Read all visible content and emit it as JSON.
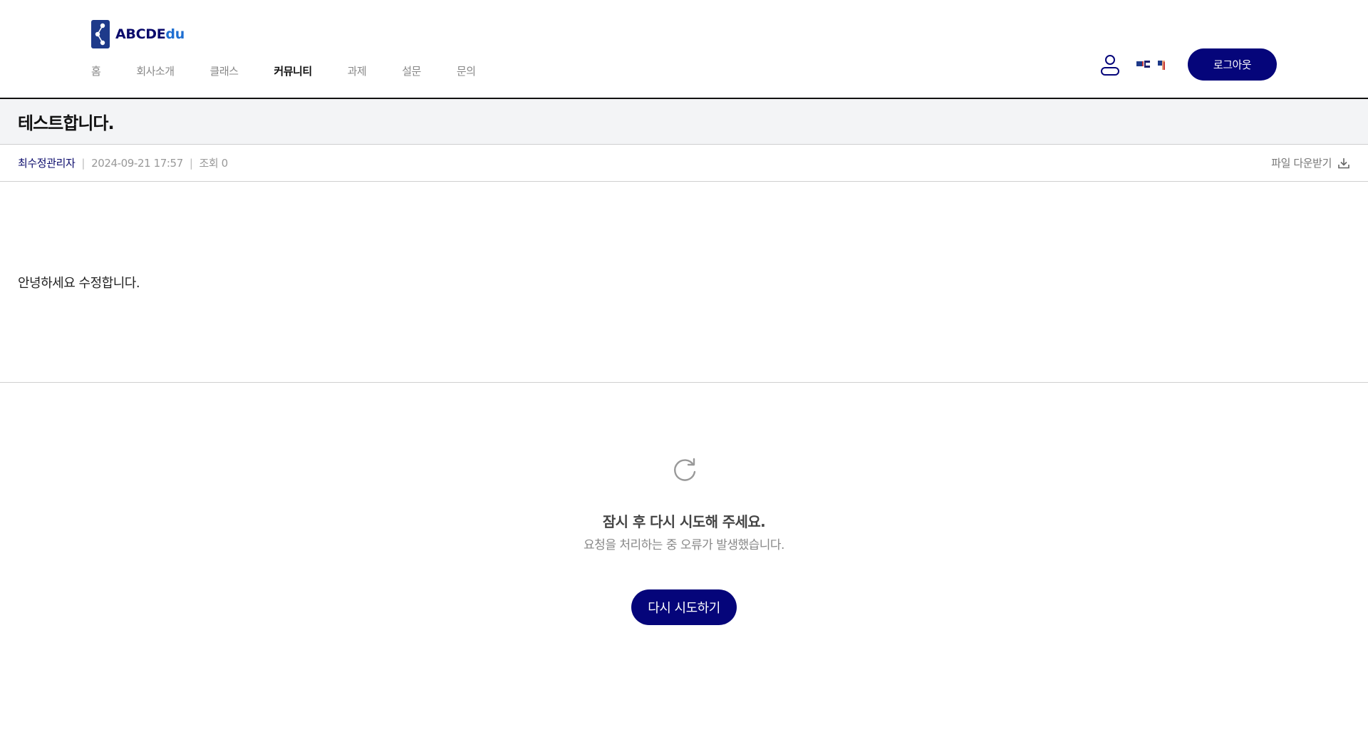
{
  "brand": {
    "name_main": "ABCDE",
    "name_accent": "du",
    "primary_color": "#05057a",
    "accent_color": "#1f6fd1"
  },
  "nav": {
    "items": [
      {
        "label": "홈"
      },
      {
        "label": "회사소개"
      },
      {
        "label": "클래스"
      },
      {
        "label": "커뮤니티",
        "active": true
      },
      {
        "label": "과제"
      },
      {
        "label": "설문"
      },
      {
        "label": "문의"
      }
    ]
  },
  "header": {
    "icons": [
      "user-icon",
      "language-flag-icon"
    ],
    "logout_label": "로그아웃"
  },
  "post": {
    "title": "테스트합니다.",
    "author": "최수정관리자",
    "date": "2024-09-21 17:57",
    "views": "조회 0",
    "download_label": "파일 다운받기",
    "body": "안녕하세요 수정합니다."
  },
  "error": {
    "icon": "refresh-icon",
    "title": "잠시 후 다시 시도해 주세요.",
    "description": "요청을 처리하는 중 오류가 발생했습니다.",
    "retry_label": "다시 시도하기"
  }
}
